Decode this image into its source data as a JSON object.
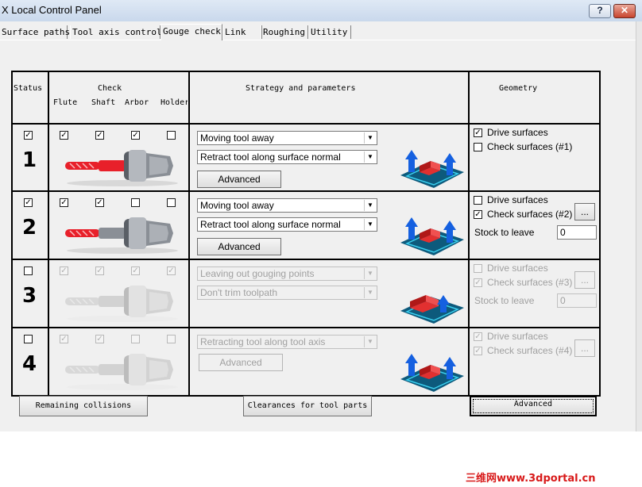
{
  "window": {
    "title": "X Local Control Panel",
    "help_btn": "?",
    "close_btn": "✕"
  },
  "tabs": [
    "Surface paths",
    "Tool axis control",
    "Gouge check",
    "Link",
    "Roughing",
    "Utility"
  ],
  "active_tab": "Gouge check",
  "headers": {
    "status": "Status",
    "check": "Check",
    "check_cols": [
      "Flute",
      "Shaft",
      "Arbor",
      "Holder"
    ],
    "strategy": "Strategy and parameters",
    "geometry": "Geometry"
  },
  "rows": [
    {
      "number": "1",
      "status": true,
      "checks": [
        true,
        true,
        true,
        false
      ],
      "enabled": true,
      "highlight": [
        "flute",
        "shaft"
      ],
      "selects": [
        "Moving tool away",
        "Retract tool along surface normal"
      ],
      "advanced": "Advanced",
      "geometry": {
        "drive_label": "Drive surfaces",
        "drive": true,
        "check_label": "Check surfaces (#1)",
        "check": false
      }
    },
    {
      "number": "2",
      "status": true,
      "checks": [
        true,
        true,
        false,
        false
      ],
      "enabled": true,
      "highlight": [
        "flute"
      ],
      "selects": [
        "Moving tool away",
        "Retract tool along surface normal"
      ],
      "advanced": "Advanced",
      "geometry": {
        "drive_label": "Drive surfaces",
        "drive": false,
        "check_label": "Check surfaces (#2)",
        "check": true,
        "stock_label": "Stock to leave",
        "stock": "0",
        "more_btn": "..."
      }
    },
    {
      "number": "3",
      "status": false,
      "checks": [
        true,
        true,
        true,
        true
      ],
      "enabled": false,
      "highlight": [],
      "selects": [
        "Leaving out gouging points",
        "Don't trim toolpath"
      ],
      "geometry": {
        "drive_label": "Drive surfaces",
        "drive": false,
        "check_label": "Check surfaces (#3)",
        "check": true,
        "stock_label": "Stock to leave",
        "stock": "0",
        "more_btn": "..."
      }
    },
    {
      "number": "4",
      "status": false,
      "checks": [
        true,
        true,
        false,
        false
      ],
      "enabled": false,
      "highlight": [],
      "selects": [
        "Retracting tool along tool axis"
      ],
      "advanced": "Advanced",
      "geometry": {
        "drive_label": "Drive surfaces",
        "drive": true,
        "check_label": "Check surfaces (#4)",
        "check": true,
        "more_btn": "..."
      }
    }
  ],
  "footer": {
    "remaining": "Remaining collisions",
    "clearances": "Clearances for tool parts",
    "advanced": "Advanced"
  },
  "watermark": "三维网www.3dportal.cn",
  "colors": {
    "highlight": "#e8202a",
    "illustration_blue": "#1560e0",
    "illustration_base": "#0d5a7c"
  }
}
